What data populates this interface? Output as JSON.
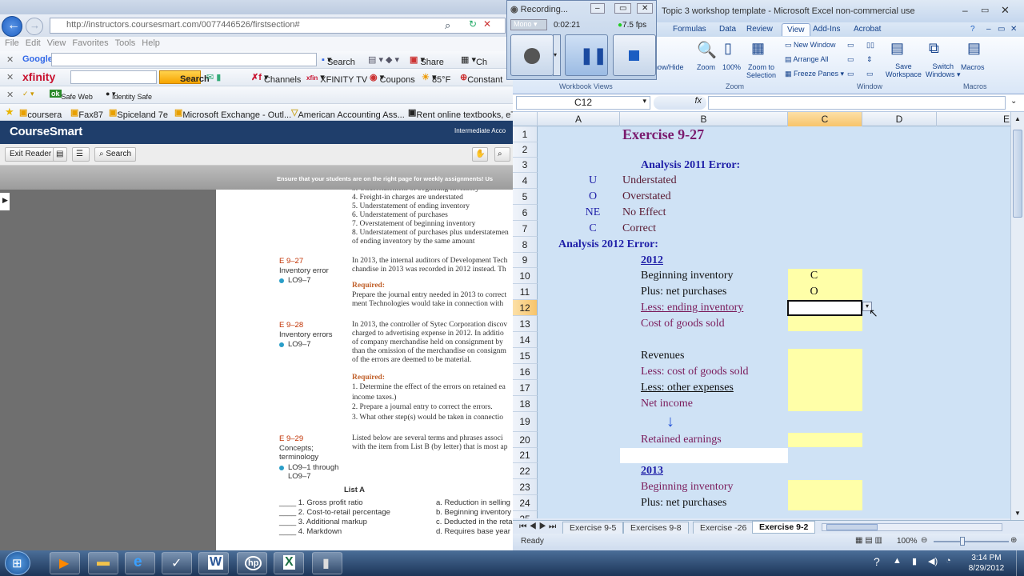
{
  "browser": {
    "url": "http://instructors.coursesmart.com/0077446526/firstsection#",
    "menu": [
      "File",
      "Edit",
      "View",
      "Favorites",
      "Tools",
      "Help"
    ],
    "google_label": "Google",
    "google_search_btn": "Search",
    "share": "Share",
    "ch_trunc": "Ch",
    "xfinity": "xfinity",
    "xfinity_search": "Search",
    "channels": "Channels",
    "xfinity_tv": "XFINITY TV",
    "coupons": "Coupons",
    "temp": "85°F",
    "constant": "Constant",
    "safe_web": "Safe Web",
    "identity_safe": "Identity Safe",
    "favorites": [
      "coursera",
      "Fax87",
      "Spiceland 7e",
      "Microsoft Exchange - Outl...",
      "American Accounting Ass...",
      "Rent online textbooks, eT..."
    ],
    "coursesmart_logo": "CourseSmart",
    "book_title": "Intermediate Acco",
    "exit_reader": "Exit Reader",
    "search_btn": "Search",
    "banner": "Ensure that your students are on the right page for weekly assignments! Us",
    "page": {
      "list_top": [
        "3.  Understatement of beginning inventory",
        "4.  Freight-in charges are understated",
        "5.  Understatement of ending inventory",
        "6.  Understatement of purchases",
        "7.  Overstatement of beginning inventory",
        "8.  Understatement of purchases plus understatemen",
        "     of ending inventory by the same amount"
      ],
      "e927_id": "E 9–27",
      "e927_title": "Inventory error",
      "e927_lo": "LO9–7",
      "e927_text": [
        "In 2013, the internal auditors of Development Tech",
        "chandise in 2013 was recorded in 2012 instead. Th"
      ],
      "required": "Required:",
      "e927_req": [
        "Prepare the journal entry needed in 2013 to correct",
        "ment Technologies would take in connection with"
      ],
      "e928_id": "E 9–28",
      "e928_title": "Inventory errors",
      "e928_lo": "LO9–7",
      "e928_text": [
        "In 2013, the controller of Sytec Corporation discov",
        "charged to advertising expense in 2012. In additio",
        "of company merchandise held on consignment by",
        "than the omission of the merchandise on consignm",
        "of the errors are deemed to be material."
      ],
      "e928_req": [
        "1.  Determine the effect of the errors on retained ea",
        "     income taxes.)",
        "2.  Prepare a journal entry to correct the errors.",
        "3.  What other step(s) would be taken in connectio"
      ],
      "e929_id": "E 9–29",
      "e929_title": [
        "Concepts;",
        "terminology"
      ],
      "e929_lo": [
        "LO9–1 through",
        "LO9–7"
      ],
      "e929_text": [
        "Listed below are several terms and phrases associ",
        "with the item from List B (by letter) that is most ap"
      ],
      "list_a": "List A",
      "list_a_items": [
        "____  1.  Gross profit ratio",
        "____  2.  Cost-to-retail percentage",
        "____  3.  Additional markup",
        "____  4.  Markdown"
      ],
      "list_b_items": [
        "a.  Reduction in selling p",
        "b.  Beginning inventory i",
        "c.  Deducted in the retai",
        "d.  Requires base year re"
      ]
    }
  },
  "recorder": {
    "title": "Recording...",
    "mode": "Mono",
    "time": "0:02:21",
    "fps": "7.5 fps"
  },
  "excel": {
    "title": "Topic 3 workshop template - Microsoft Excel non-commercial use",
    "tabs": [
      "Formulas",
      "Data",
      "Review",
      "View",
      "Add-Ins",
      "Acrobat"
    ],
    "active_tab": "View",
    "ribbon": {
      "show_hide": "how/Hide",
      "zoom": "Zoom",
      "zoom100": "100%",
      "zoom_sel": [
        "Zoom to",
        "Selection"
      ],
      "new_window": "New Window",
      "arrange_all": "Arrange All",
      "freeze_panes": "Freeze Panes",
      "save_ws": [
        "Save",
        "Workspace"
      ],
      "switch_windows": [
        "Switch",
        "Windows"
      ],
      "macros": "Macros",
      "grp_workbook_views": "Workbook Views",
      "grp_zoom": "Zoom",
      "grp_window": "Window",
      "grp_macros": "Macros"
    },
    "name_box": "C12",
    "fx": "fx",
    "columns": [
      "A",
      "B",
      "C",
      "D",
      "E"
    ],
    "rows": [
      {
        "n": "1",
        "b": "Exercise 9-27"
      },
      {
        "n": "2"
      },
      {
        "n": "3",
        "b": "Analysis 2011 Error:"
      },
      {
        "n": "4",
        "a": "U",
        "b": "Understated"
      },
      {
        "n": "5",
        "a": "O",
        "b": "Overstated"
      },
      {
        "n": "6",
        "a": "NE",
        "b": "No Effect"
      },
      {
        "n": "7",
        "a": "C",
        "b": "Correct"
      },
      {
        "n": "8",
        "a": "Analysis 2012 Error:"
      },
      {
        "n": "9",
        "b": "2012"
      },
      {
        "n": "10",
        "b": "Beginning inventory",
        "c": "C"
      },
      {
        "n": "11",
        "b": "Plus: net purchases",
        "c": "O"
      },
      {
        "n": "12",
        "b": "Less: ending inventory"
      },
      {
        "n": "13",
        "b": "Cost of goods sold"
      },
      {
        "n": "14"
      },
      {
        "n": "15",
        "b": "Revenues"
      },
      {
        "n": "16",
        "b": "Less: cost of goods sold"
      },
      {
        "n": "17",
        "b": "Less: other expenses"
      },
      {
        "n": "18",
        "b": "Net income"
      },
      {
        "n": "19",
        "b": "↓"
      },
      {
        "n": "20",
        "b": "Retained earnings"
      },
      {
        "n": "21"
      },
      {
        "n": "22",
        "b": "2013"
      },
      {
        "n": "23",
        "b": "Beginning inventory"
      },
      {
        "n": "24",
        "b": "Plus: net purchases"
      },
      {
        "n": "25"
      }
    ],
    "sheets": [
      "Exercise 9-5",
      "Exercises 9-8",
      "Exercise -26",
      "Exercise 9-2"
    ],
    "active_sheet": "Exercise 9-2",
    "status": "Ready",
    "zoom_level": "100%"
  },
  "taskbar": {
    "time": "3:14 PM",
    "date": "8/29/2012"
  }
}
